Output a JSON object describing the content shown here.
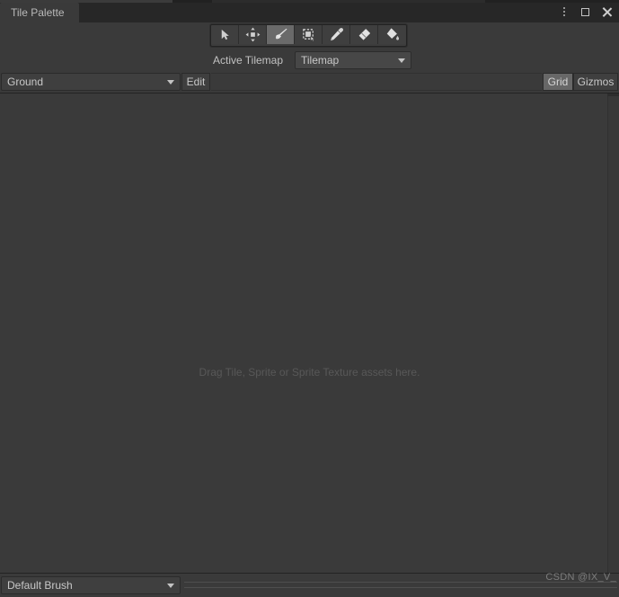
{
  "window": {
    "tab_label": "Tile Palette",
    "controls": {
      "menu_icon": "kebab-menu-icon",
      "maximize_icon": "maximize-icon",
      "close_icon": "close-icon"
    }
  },
  "toolbar": {
    "tools": [
      {
        "name": "select-tool",
        "icon": "cursor-arrow-icon",
        "active": false,
        "tooltip": "Select"
      },
      {
        "name": "move-tool",
        "icon": "move-arrows-icon",
        "active": false,
        "tooltip": "Move"
      },
      {
        "name": "paint-tool",
        "icon": "paintbrush-icon",
        "active": true,
        "tooltip": "Paint"
      },
      {
        "name": "box-fill-tool",
        "icon": "box-select-icon",
        "active": false,
        "tooltip": "Box Fill"
      },
      {
        "name": "picker-tool",
        "icon": "eyedropper-icon",
        "active": false,
        "tooltip": "Picker"
      },
      {
        "name": "erase-tool",
        "icon": "eraser-icon",
        "active": false,
        "tooltip": "Erase"
      },
      {
        "name": "fill-tool",
        "icon": "paint-bucket-icon",
        "active": false,
        "tooltip": "Fill"
      }
    ]
  },
  "active_tilemap": {
    "label": "Active Tilemap",
    "value": "Tilemap"
  },
  "palette_row": {
    "palette_value": "Ground",
    "edit_label": "Edit",
    "grid_label": "Grid",
    "gizmos_label": "Gizmos",
    "grid_active": true,
    "gizmos_active": false
  },
  "canvas": {
    "drop_hint": "Drag Tile, Sprite or Sprite Texture assets here."
  },
  "bottom_bar": {
    "brush_value": "Default Brush"
  },
  "watermark": {
    "text": "CSDN @IX_V_"
  },
  "colors": {
    "window_bg": "#3a3a3a",
    "tabstrip_bg": "#272727",
    "field_bg": "#474747",
    "button_bg": "#3f3f3f",
    "button_active_bg": "#6a6a6a",
    "text": "#c4c4c4",
    "hint_text": "#585858",
    "border": "#2b2b2b"
  }
}
